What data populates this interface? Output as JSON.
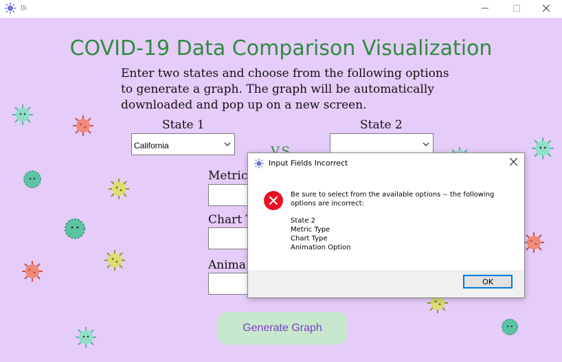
{
  "window": {
    "title": "tk",
    "minimize_icon": "minimize-icon",
    "maximize_icon": "maximize-icon",
    "close_icon": "close-icon"
  },
  "app": {
    "heading": "COVID-19 Data Comparison Visualization",
    "description_lines": [
      "Enter two states and choose from the following options",
      "to generate a graph. The graph will be automatically",
      "downloaded and pop up on a new screen."
    ],
    "state1": {
      "label": "State 1",
      "value": "California"
    },
    "state2": {
      "label": "State 2",
      "value": ""
    },
    "vs_label": "V.S.",
    "metric_label": "Metric",
    "chart_label": "Chart T",
    "anim_label": "Anima",
    "generate_button": "Generate Graph"
  },
  "dialog": {
    "title": "Input Fields Incorrect",
    "message_line1": "Be sure to select from the available options -- the following",
    "message_line2": "options are incorrect:",
    "items": [
      "State 2",
      "Metric Type",
      "Chart Type",
      "Animation Option"
    ],
    "ok_label": "OK",
    "icon": "error-icon"
  },
  "colors": {
    "background": "#e6ccf9",
    "title_green": "#2e8b3e",
    "button_bg": "#c7e8cd",
    "button_text": "#7c3fc4",
    "error_red": "#e81123"
  }
}
